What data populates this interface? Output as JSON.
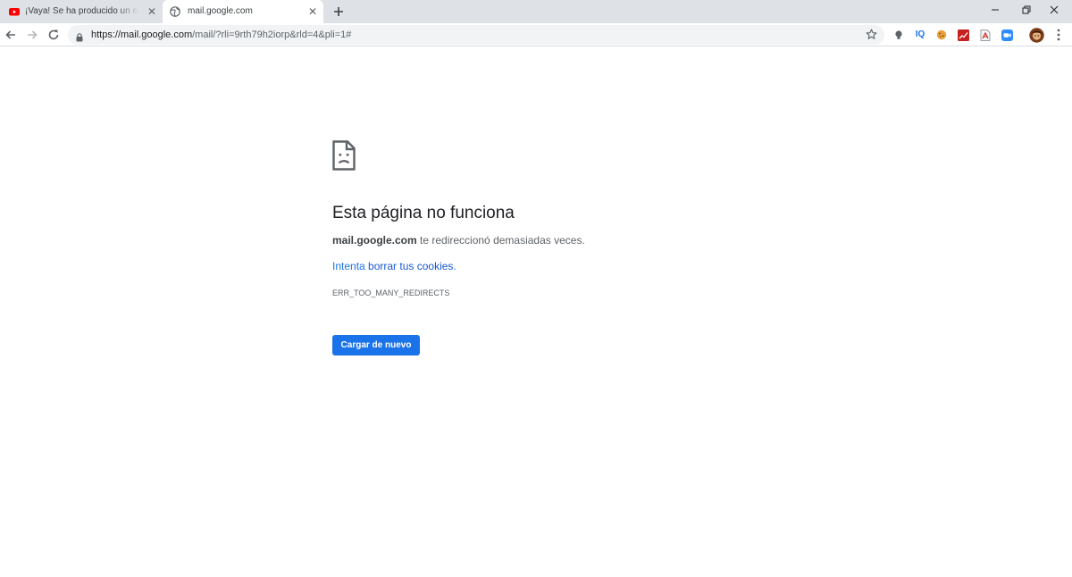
{
  "tabs": [
    {
      "title": "¡Vaya! Se ha producido un error",
      "active": false,
      "favicon": "youtube-icon"
    },
    {
      "title": "mail.google.com",
      "active": true,
      "favicon": "globe-icon"
    }
  ],
  "toolbar": {
    "url_host": "https://mail.google.com",
    "url_path": "/mail/?rli=9rth79h2iorp&rld=4&pli=1#",
    "extensions": [
      "lightbulb-icon",
      "iq-icon",
      "cookie-icon",
      "chart-extension-icon",
      "pdf-icon",
      "zoom-icon",
      "avatar-icon"
    ],
    "extensions_text": {
      "iq": "IQ"
    }
  },
  "error": {
    "icon": "sad-page-icon",
    "heading": "Esta página no funciona",
    "host": "mail.google.com",
    "message": " te redireccionó demasiadas veces.",
    "suggestion_prefix": "Intenta ",
    "suggestion_link": "borrar tus cookies",
    "suggestion_suffix": ".",
    "code": "ERR_TOO_MANY_REDIRECTS",
    "reload_label": "Cargar de nuevo"
  },
  "colors": {
    "tabstrip": "#dee1e6",
    "accent": "#1a73e8",
    "text": "#202124"
  }
}
